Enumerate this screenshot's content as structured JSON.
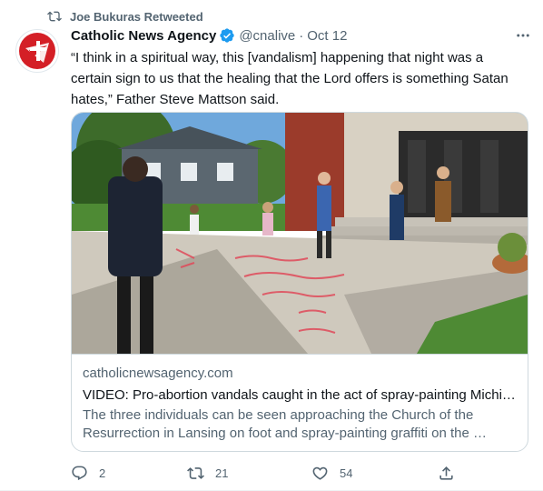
{
  "context": {
    "retweeted_by": "Joe Bukuras Retweeted",
    "icon": "retweet-icon"
  },
  "author": {
    "display_name": "Catholic News Agency",
    "handle": "@cnalive",
    "separator": "·",
    "date": "Oct 12",
    "verified": true,
    "avatar_icon": "cna-logo"
  },
  "tweet": {
    "text": "“I think in a spiritual way, this [vandalism] happening that night was a certain sign to us that the healing that the Lord offers is something Satan hates,” Father Steve Mattson said."
  },
  "card": {
    "image_description_icon": "photo",
    "domain": "catholicnewsagency.com",
    "title": "VIDEO: Pro-abortion vandals caught in the act of spray-painting Michi…",
    "description": "The three individuals can be seen approaching the Church of the Resurrection in Lansing on foot and spray-painting graffiti on the …"
  },
  "actions": {
    "reply_count": "2",
    "retweet_count": "21",
    "like_count": "54",
    "share_icon": "share-icon"
  },
  "colors": {
    "accent": "#1d9bf0",
    "secondary_text": "#536471",
    "primary_text": "#0f1419",
    "border": "#cfd9de",
    "logo_red": "#d41f26"
  }
}
